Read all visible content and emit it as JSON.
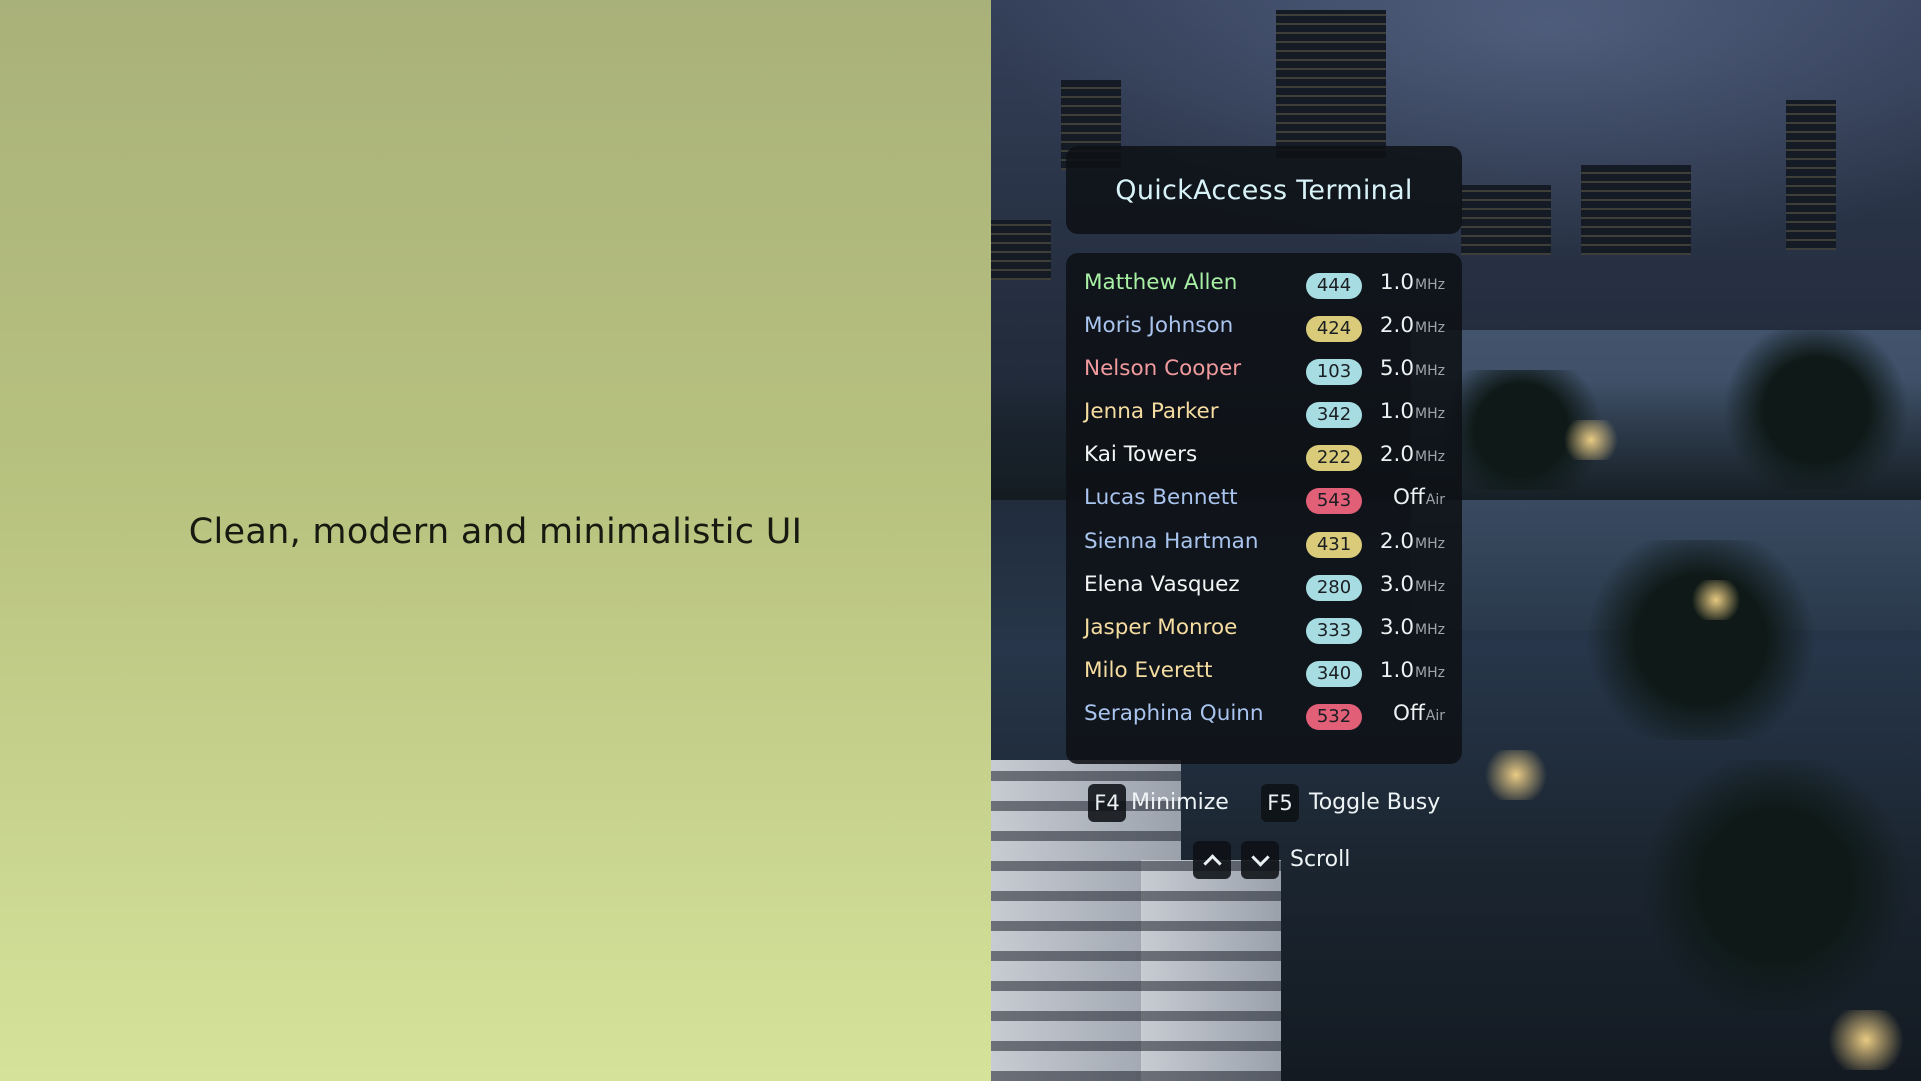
{
  "promo": {
    "tagline": "Clean, modern and minimalistic UI"
  },
  "terminal": {
    "title": "QuickAccess Terminal",
    "players": [
      {
        "name": "Matthew Allen",
        "id": "444",
        "freq": "1.0",
        "unit": "MHz",
        "name_color": "#a8f0a4",
        "badge_color": "#a7dde2"
      },
      {
        "name": "Moris Johnson",
        "id": "424",
        "freq": "2.0",
        "unit": "MHz",
        "name_color": "#a9c4ee",
        "badge_color": "#d9cb7a"
      },
      {
        "name": "Nelson Cooper",
        "id": "103",
        "freq": "5.0",
        "unit": "MHz",
        "name_color": "#f09a9d",
        "badge_color": "#a7dde2"
      },
      {
        "name": "Jenna Parker",
        "id": "342",
        "freq": "1.0",
        "unit": "MHz",
        "name_color": "#f5dca0",
        "badge_color": "#a7dde2"
      },
      {
        "name": "Kai Towers",
        "id": "222",
        "freq": "2.0",
        "unit": "MHz",
        "name_color": "#f3f5f5",
        "badge_color": "#d9cb7a"
      },
      {
        "name": "Lucas Bennett",
        "id": "543",
        "freq": "Off",
        "unit": "Air",
        "name_color": "#a9c4ee",
        "badge_color": "#e25f78"
      },
      {
        "name": "Sienna Hartman",
        "id": "431",
        "freq": "2.0",
        "unit": "MHz",
        "name_color": "#a9c4ee",
        "badge_color": "#d9cb7a"
      },
      {
        "name": "Elena Vasquez",
        "id": "280",
        "freq": "3.0",
        "unit": "MHz",
        "name_color": "#f3f5f5",
        "badge_color": "#a7dde2"
      },
      {
        "name": "Jasper Monroe",
        "id": "333",
        "freq": "3.0",
        "unit": "MHz",
        "name_color": "#f5dca0",
        "badge_color": "#a7dde2"
      },
      {
        "name": "Milo Everett",
        "id": "340",
        "freq": "1.0",
        "unit": "MHz",
        "name_color": "#f5dca0",
        "badge_color": "#a7dde2"
      },
      {
        "name": "Seraphina Quinn",
        "id": "532",
        "freq": "Off",
        "unit": "Air",
        "name_color": "#a9c4ee",
        "badge_color": "#e25f78"
      }
    ]
  },
  "hints": {
    "minimize_key": "F4",
    "minimize_label": "Minimize",
    "busy_key": "F5",
    "busy_label": "Toggle Busy",
    "scroll_label": "Scroll",
    "scroll_up_icon": "chevron-up-icon",
    "scroll_down_icon": "chevron-down-icon"
  }
}
